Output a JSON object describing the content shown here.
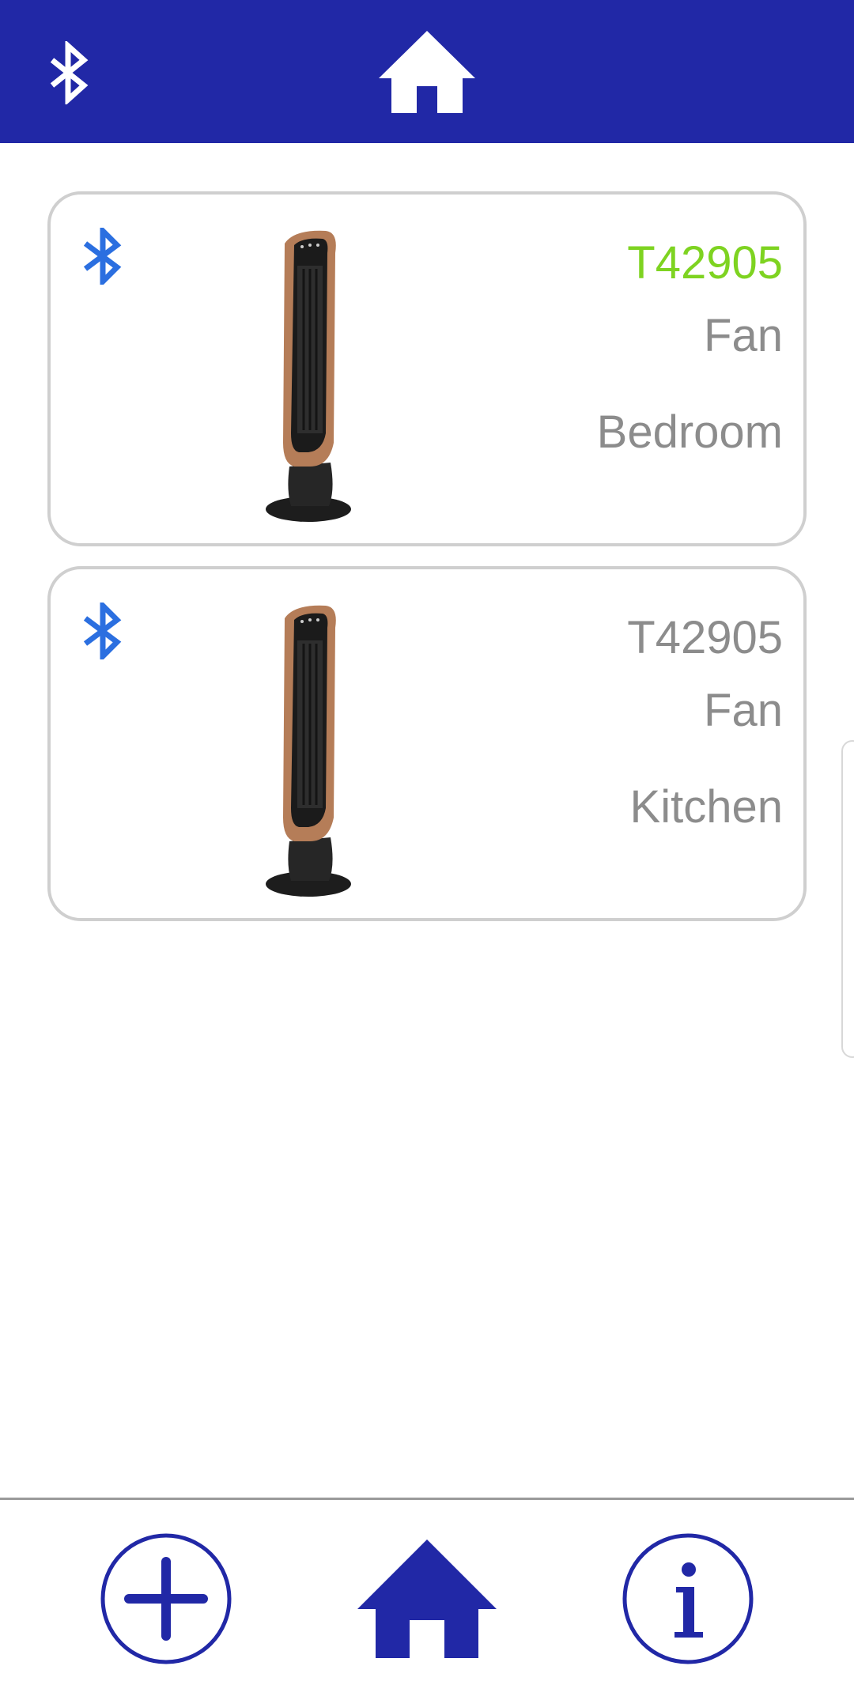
{
  "header": {
    "bluetooth_icon": "bluetooth-icon",
    "home_icon": "home-icon",
    "color": "#2128a6"
  },
  "devices": [
    {
      "model": "T42905",
      "model_color": "#7ed321",
      "type": "Fan",
      "room": "Bedroom",
      "connection_icon": "bluetooth-icon",
      "image": "tower-fan"
    },
    {
      "model": "T42905",
      "model_color": "#8c8c8c",
      "type": "Fan",
      "room": "Kitchen",
      "connection_icon": "bluetooth-icon",
      "image": "tower-fan"
    }
  ],
  "bottom_nav": {
    "items": [
      {
        "icon": "add-icon"
      },
      {
        "icon": "home-icon"
      },
      {
        "icon": "info-icon"
      }
    ],
    "color": "#2128a6"
  }
}
